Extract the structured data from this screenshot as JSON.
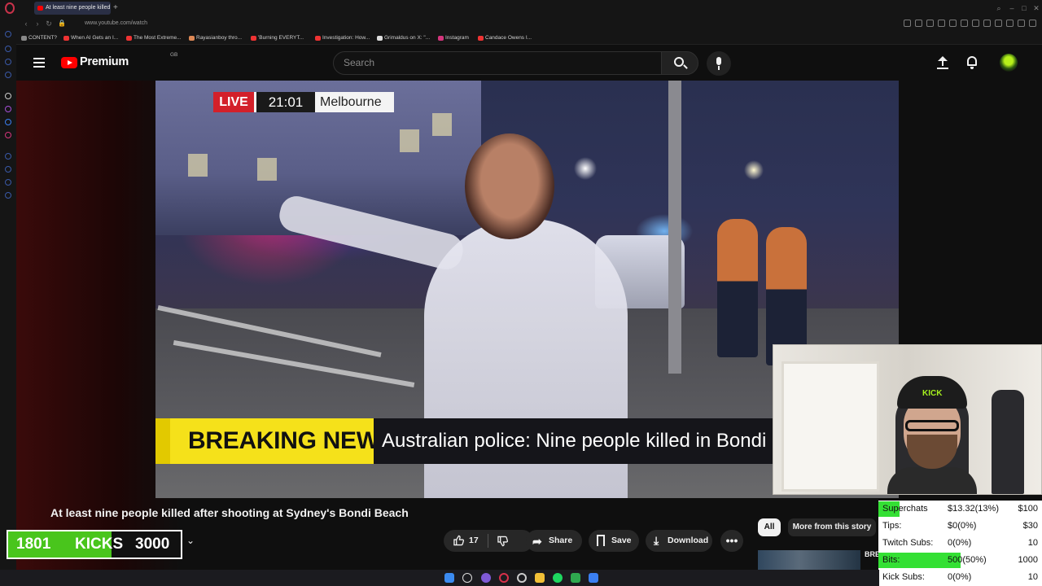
{
  "browser": {
    "tab_title": "At least nine people killed",
    "url": "www.youtube.com/watch",
    "bookmarks": [
      "CONTENT?",
      "When AI Gets an I...",
      "The Most Extreme...",
      "Rayasianboy thro...",
      "'Burning EVERYT...",
      "Investigation: How...",
      "Grimaldus on X: \"...",
      "Instagram",
      "Candace Owens I..."
    ]
  },
  "youtube": {
    "logo_text": "Premium",
    "country_code": "GB",
    "search_placeholder": "Search",
    "video": {
      "live_label": "LIVE",
      "live_time": "21:01",
      "live_city": "Melbourne",
      "breaking_label": "BREAKING NEWS",
      "breaking_text": "Australian police: Nine people killed in Bondi"
    },
    "title": "At least nine people killed after shooting at Sydney's Bondi Beach",
    "actions": {
      "like_count": "17",
      "share": "Share",
      "save": "Save",
      "download": "Download",
      "more": "•••"
    },
    "chips": {
      "all": "All",
      "more_story": "More from this story"
    },
    "rec_text": "BRE"
  },
  "overlay": {
    "kicks": {
      "current": "1801",
      "label": "KICKS",
      "goal": "3000",
      "progress": 0.6
    },
    "webcam_cap_text": "KICK",
    "stats": [
      {
        "label": "Superchats",
        "value": "$13.32(13%)",
        "goal": "$100",
        "progress": 0.13
      },
      {
        "label": "Tips:",
        "value": "$0(0%)",
        "goal": "$30",
        "progress": 0
      },
      {
        "label": "Twitch Subs:",
        "value": "0(0%)",
        "goal": "10",
        "progress": 0
      },
      {
        "label": "Bits:",
        "value": "500(50%)",
        "goal": "1000",
        "progress": 0.5
      },
      {
        "label": "Kick Subs:",
        "value": "0(0%)",
        "goal": "10",
        "progress": 0
      }
    ],
    "colors": {
      "kick_green": "#49c51c",
      "bar_green": "#34e034",
      "breaking_yellow": "#f5e11a",
      "live_red": "#d3202a",
      "youtube_red": "#ff0000"
    }
  }
}
